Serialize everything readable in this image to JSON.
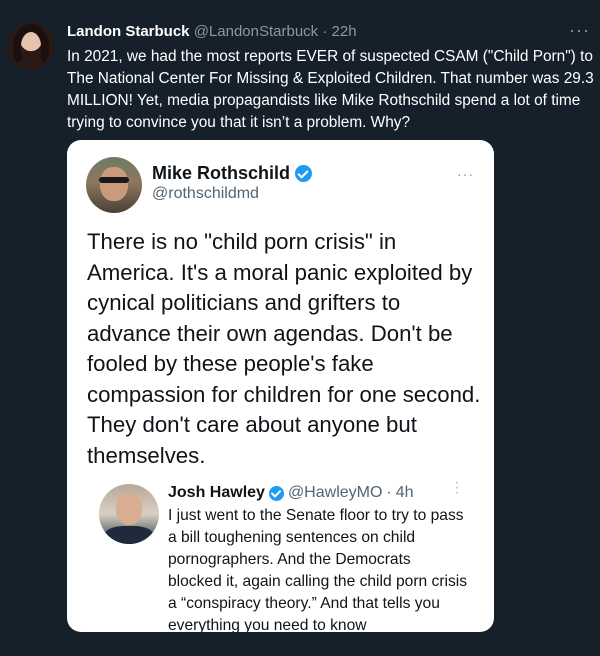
{
  "outer_tweet": {
    "author_name": "Landon Starbuck",
    "author_handle": "@LandonStarbuck",
    "separator": "·",
    "time": "22h",
    "text": "In 2021, we had the most reports EVER of suspected CSAM (\"Child Porn\") to The National Center For Missing & Exploited Children. That number was 29.3 MILLION! Yet, media propagandists like Mike Rothschild spend a lot of time trying to convince you that it isn’t a problem. Why?",
    "more_icon": "···"
  },
  "screenshot_card": {
    "author_name": "Mike Rothschild",
    "author_handle": "@rothschildmd",
    "verified": true,
    "more_icon": "···",
    "text": "There is no \"child porn crisis\" in America. It's a moral panic exploited by cynical politicians and grifters to advance their own agendas. Don't be fooled by these people's fake compassion for children for one second. They don't care about anyone but themselves.",
    "quoted_tweet": {
      "author_name": "Josh Hawley",
      "author_handle": "@HawleyMO",
      "separator": "·",
      "time": "4h",
      "verified": true,
      "more_icon": "⋮",
      "text": "I just went to the Senate floor to try to pass a bill toughening sentences on child pornographers. And the Democrats blocked it, again calling the child porn crisis a “conspiracy theory.” And that tells you everything you need to know"
    }
  },
  "colors": {
    "background": "#15202b",
    "card_background": "#ffffff",
    "verified_blue": "#1d9bf0",
    "secondary_text_dark": "#8b98a5",
    "secondary_text_light": "#536471"
  }
}
